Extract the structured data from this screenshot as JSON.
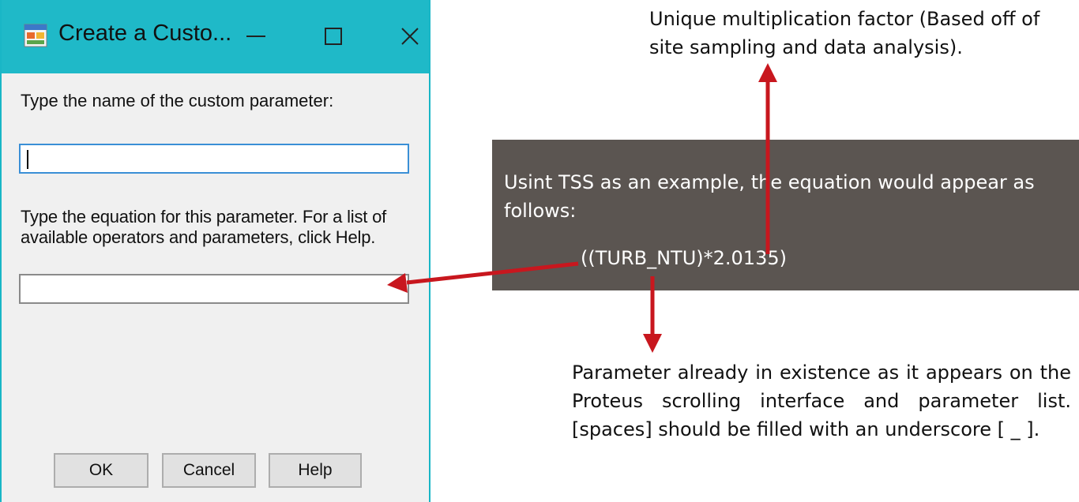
{
  "dialog": {
    "title": "Create a Custo...",
    "prompt_name": "Type the name of the custom parameter:",
    "name_field_value": "",
    "prompt_equation": "Type the equation for this parameter.  For a list of available operators and parameters, click Help.",
    "equation_field_value": "",
    "buttons": {
      "ok": "OK",
      "cancel": "Cancel",
      "help": "Help"
    },
    "titlebar_color": "#1fb9c8"
  },
  "annotation": {
    "box_text": "Usint TSS as an example, the equation would appear as follows:",
    "equation": "((TURB_NTU)*2.0135)",
    "top_note": "Unique multiplication factor (Based off of site sampling and data analysis).",
    "bottom_note": "Parameter already in existence as it appears on the Proteus scrolling interface and parameter list. [spaces] should be filled with an underscore [ _ ].",
    "box_color": "#5b5551",
    "arrow_color": "#c8171e"
  }
}
